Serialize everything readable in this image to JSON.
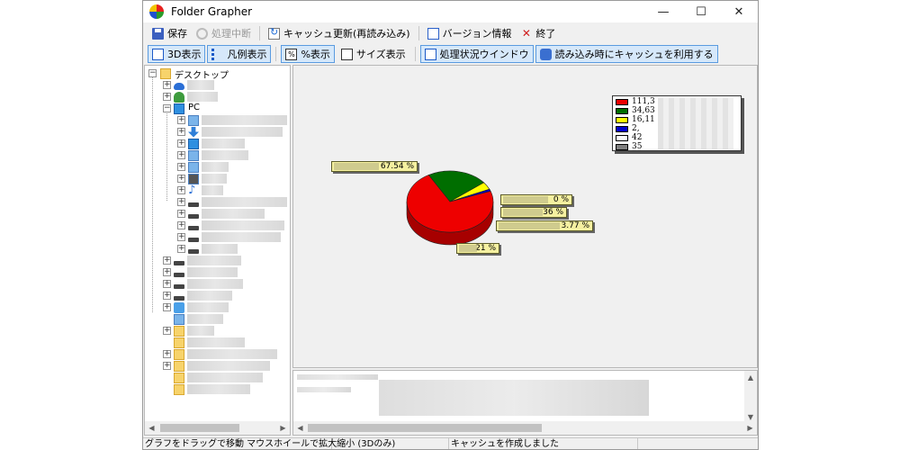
{
  "window": {
    "title": "Folder Grapher",
    "minimize": "—",
    "maximize": "☐",
    "close": "✕"
  },
  "toolbar": {
    "save": "保存",
    "stop": "処理中断",
    "refresh_cache": "キャッシュ更新(再読み込み)",
    "version": "バージョン情報",
    "exit": "終了"
  },
  "view_toolbar": {
    "view_3d": "3D表示",
    "legend": "凡例表示",
    "percent": "%表示",
    "size": "サイズ表示",
    "progress_window": "処理状況ウインドウ",
    "use_cache": "読み込み時にキャッシュを利用する"
  },
  "tree": {
    "root": "デスクトップ",
    "pc": "PC"
  },
  "chart_data": {
    "type": "pie",
    "style": "3d",
    "slices": [
      {
        "color": "#ee0000",
        "value": 67.54,
        "label": "67.54 %"
      },
      {
        "color": "#006e00",
        "value": 21,
        "label": "21 %"
      },
      {
        "color": "#ffff00",
        "value": 3.77,
        "label": "3.77 %"
      },
      {
        "color": "#0000cc",
        "value": 1,
        "label": ""
      },
      {
        "color": "#ffffff",
        "value": 0,
        "label": "0 %"
      },
      {
        "color": "#808080",
        "value": 0,
        "label": ""
      }
    ],
    "extra_labels": [
      "36 %"
    ],
    "legend_placement": "top-right",
    "legend": [
      {
        "color": "#ee0000",
        "text": "111,3"
      },
      {
        "color": "#006e00",
        "text": "34,63"
      },
      {
        "color": "#ffff00",
        "text": "16,11"
      },
      {
        "color": "#0000cc",
        "text": "2,"
      },
      {
        "color": "#ffffff",
        "text": "42"
      },
      {
        "color": "#808080",
        "text": "35"
      }
    ]
  },
  "status": {
    "hint": "グラフをドラッグで移動 マウスホイールで拡大縮小 (3Dのみ)",
    "message": "キャッシュを作成しました"
  }
}
